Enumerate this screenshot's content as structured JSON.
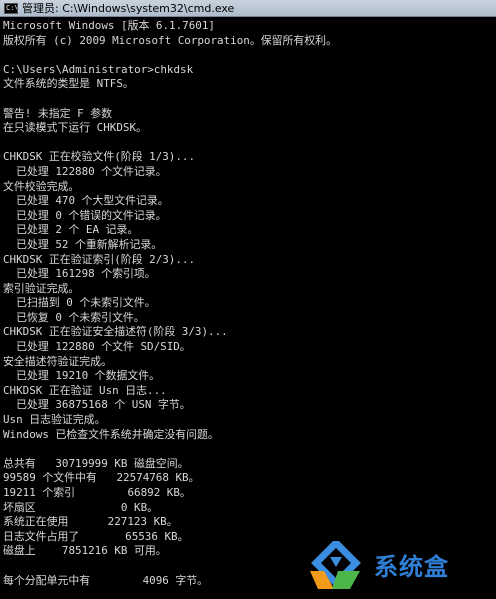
{
  "window": {
    "title": "管理员: C:\\Windows\\system32\\cmd.exe",
    "icon_label": "C:\\"
  },
  "console": {
    "lines": [
      "Microsoft Windows [版本 6.1.7601]",
      "版权所有 (c) 2009 Microsoft Corporation。保留所有权利。",
      "",
      "C:\\Users\\Administrator>chkdsk",
      "文件系统的类型是 NTFS。",
      "",
      "警告! 未指定 F 参数",
      "在只读模式下运行 CHKDSK。",
      "",
      "CHKDSK 正在校验文件(阶段 1/3)...",
      "  已处理 122880 个文件记录。",
      "文件校验完成。",
      "  已处理 470 个大型文件记录。",
      "  已处理 0 个错误的文件记录。",
      "  已处理 2 个 EA 记录。",
      "  已处理 52 个重新解析记录。",
      "CHKDSK 正在验证索引(阶段 2/3)...",
      "  已处理 161298 个索引项。",
      "索引验证完成。",
      "  已扫描到 0 个未索引文件。",
      "  已恢复 0 个未索引文件。",
      "CHKDSK 正在验证安全描述符(阶段 3/3)...",
      "  已处理 122880 个文件 SD/SID。",
      "安全描述符验证完成。",
      "  已处理 19210 个数据文件。",
      "CHKDSK 正在验证 Usn 日志...",
      "  已处理 36875168 个 USN 字节。",
      "Usn 日志验证完成。",
      "Windows 已检查文件系统并确定没有问题。",
      "",
      "总共有   30719999 KB 磁盘空间。",
      "99589 个文件中有   22574768 KB。",
      "19211 个索引        66892 KB。",
      "坏扇区             0 KB。",
      "系统正在使用      227123 KB。",
      "日志文件占用了       65536 KB。",
      "磁盘上    7851216 KB 可用。",
      "",
      "每个分配单元中有        4096 字节。"
    ]
  },
  "watermark": {
    "text": "系统盒",
    "colors": [
      "#3b8ee0",
      "#f29a1a",
      "#4cb648",
      "#2f7fd6"
    ]
  }
}
